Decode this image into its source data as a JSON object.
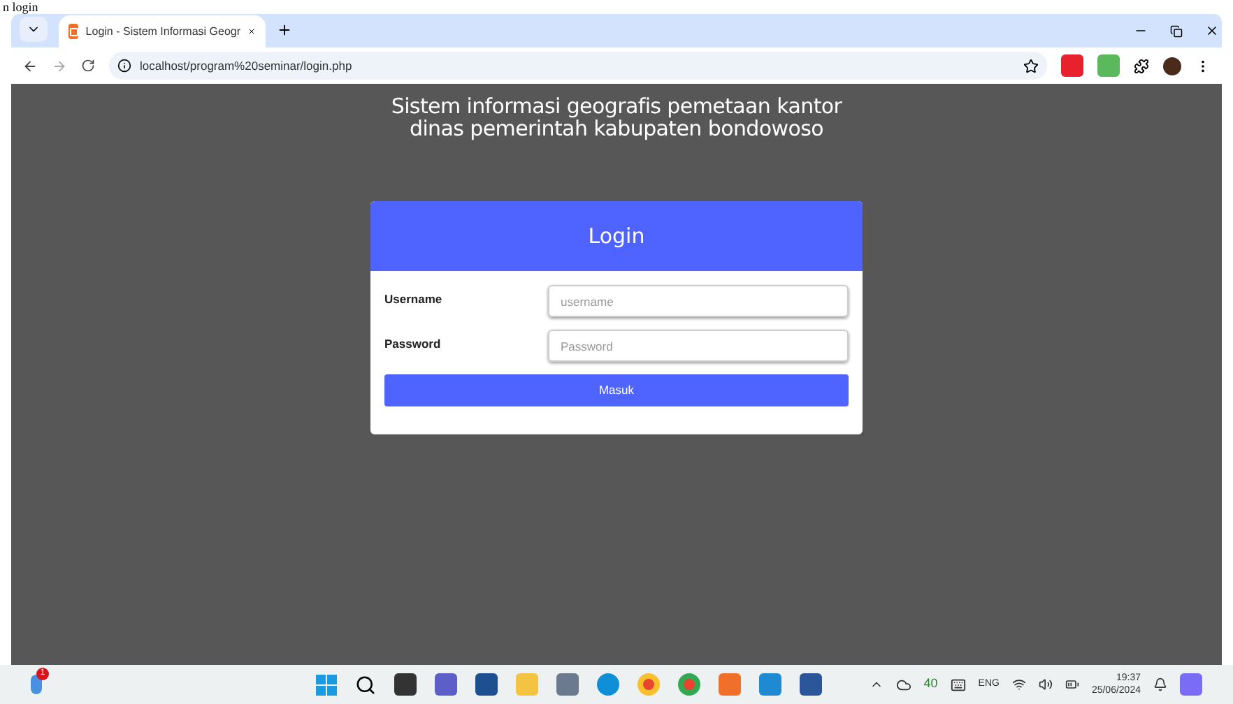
{
  "caption": "n login",
  "browser": {
    "tab": {
      "title": "Login - Sistem Informasi Geogr",
      "selected": true
    },
    "address": "localhost/program%20seminar/login.php"
  },
  "page": {
    "heading": "Sistem informasi geografis pemetaan kantor dinas pemerintah kabupaten bondowoso",
    "card": {
      "title": "Login",
      "fields": [
        {
          "label": "Username",
          "placeholder": "username"
        },
        {
          "label": "Password",
          "placeholder": "Password"
        }
      ],
      "button": "Masuk"
    }
  },
  "taskbar": {
    "weather_badge": "1",
    "tray": {
      "temperature": "40",
      "language": "ENG",
      "time": "19:37",
      "date": "25/06/2024"
    }
  }
}
